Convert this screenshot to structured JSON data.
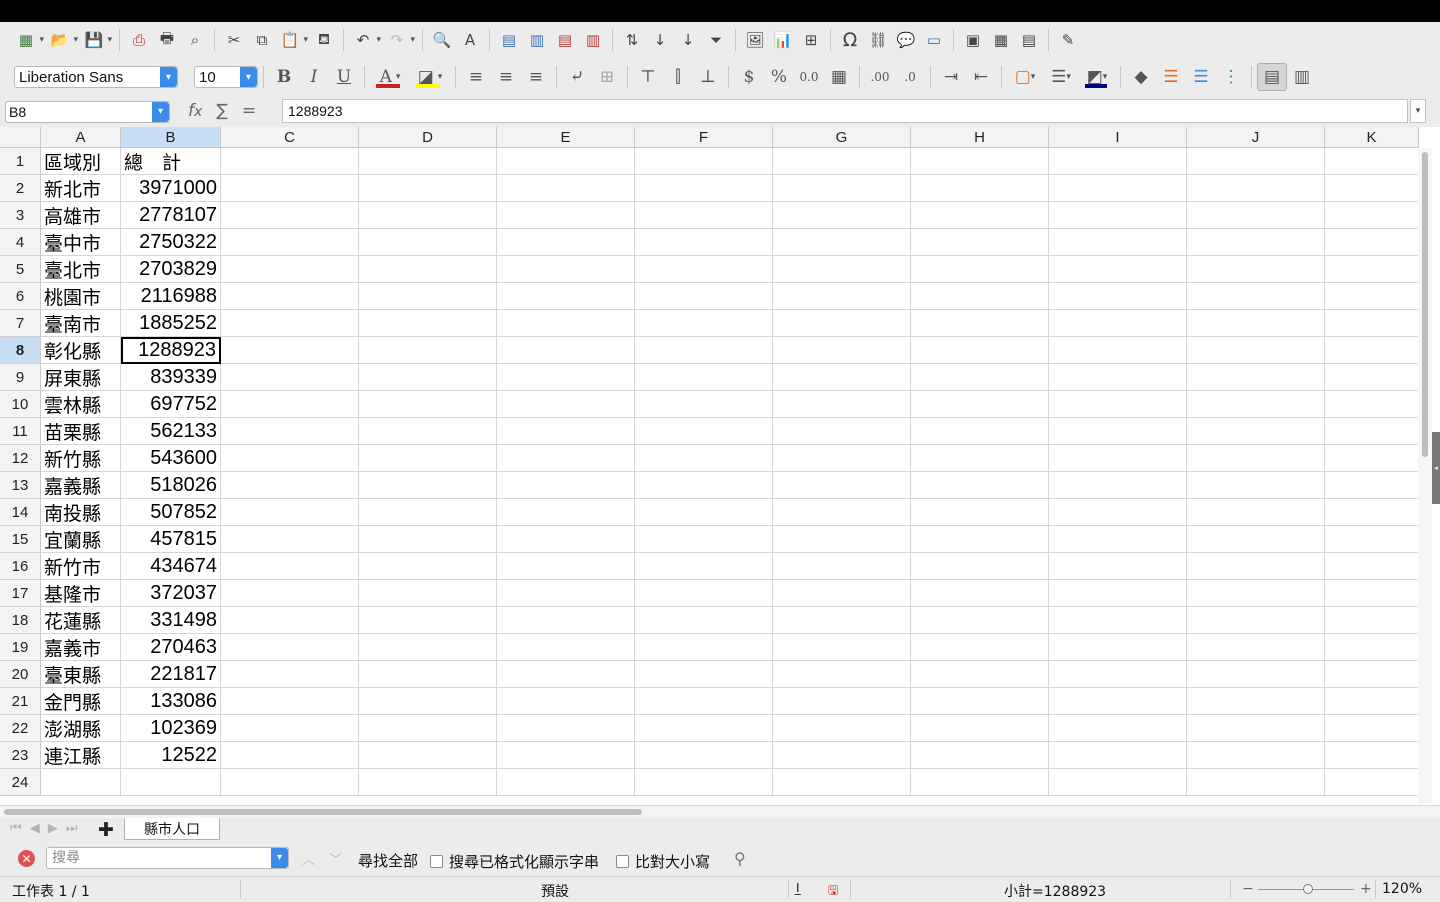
{
  "toolbar1": {
    "icons": [
      "table-icon",
      "open-icon",
      "save-icon",
      "export-pdf-icon",
      "print-icon",
      "print-preview-icon",
      "cut-icon",
      "copy-icon",
      "paste-icon",
      "clone-format-icon",
      "undo-icon",
      "redo-icon",
      "find-replace-icon",
      "spelling-icon",
      "row-icon",
      "column-icon",
      "delete-row-icon",
      "delete-column-icon",
      "sort-icon",
      "sort-ascending-icon",
      "sort-descending-icon",
      "autofilter-icon",
      "image-icon",
      "chart-icon",
      "pivot-table-icon",
      "special-character-icon",
      "hyperlink-icon",
      "comment-icon",
      "header-footer-icon",
      "define-print-area-icon",
      "freeze-rows-icon",
      "split-window-icon",
      "show-draw-functions-icon"
    ]
  },
  "format": {
    "font_name": "Liberation Sans",
    "font_size": "10",
    "font_color": "#c9211e",
    "highlight_color": "#ffff00",
    "border_color": "#000080"
  },
  "formula_bar": {
    "cell_ref": "B8",
    "content": "1288923"
  },
  "columns": [
    "A",
    "B",
    "C",
    "D",
    "E",
    "F",
    "G",
    "H",
    "I",
    "J",
    "K"
  ],
  "selected_column": "B",
  "selected_row": 8,
  "rows": [
    {
      "num": "1",
      "a": "區域別",
      "b": "總　計",
      "b_text": true
    },
    {
      "num": "2",
      "a": "新北市",
      "b": "3971000"
    },
    {
      "num": "3",
      "a": "高雄市",
      "b": "2778107"
    },
    {
      "num": "4",
      "a": "臺中市",
      "b": "2750322"
    },
    {
      "num": "5",
      "a": "臺北市",
      "b": "2703829"
    },
    {
      "num": "6",
      "a": "桃園市",
      "b": "2116988"
    },
    {
      "num": "7",
      "a": "臺南市",
      "b": "1885252"
    },
    {
      "num": "8",
      "a": "彰化縣",
      "b": "1288923"
    },
    {
      "num": "9",
      "a": "屏東縣",
      "b": "839339"
    },
    {
      "num": "10",
      "a": "雲林縣",
      "b": "697752"
    },
    {
      "num": "11",
      "a": "苗栗縣",
      "b": "562133"
    },
    {
      "num": "12",
      "a": "新竹縣",
      "b": "543600"
    },
    {
      "num": "13",
      "a": "嘉義縣",
      "b": "518026"
    },
    {
      "num": "14",
      "a": "南投縣",
      "b": "507852"
    },
    {
      "num": "15",
      "a": "宜蘭縣",
      "b": "457815"
    },
    {
      "num": "16",
      "a": "新竹市",
      "b": "434674"
    },
    {
      "num": "17",
      "a": "基隆市",
      "b": "372037"
    },
    {
      "num": "18",
      "a": "花蓮縣",
      "b": "331498"
    },
    {
      "num": "19",
      "a": "嘉義市",
      "b": "270463"
    },
    {
      "num": "20",
      "a": "臺東縣",
      "b": "221817"
    },
    {
      "num": "21",
      "a": "金門縣",
      "b": "133086"
    },
    {
      "num": "22",
      "a": "澎湖縣",
      "b": "102369"
    },
    {
      "num": "23",
      "a": "連江縣",
      "b": "12522"
    },
    {
      "num": "24",
      "a": "",
      "b": ""
    }
  ],
  "sheet_tab": "縣市人口",
  "find": {
    "placeholder": "搜尋",
    "find_all": "尋找全部",
    "formatted_display": "搜尋已格式化顯示字串",
    "match_case": "比對大小寫"
  },
  "status": {
    "sheet": "工作表 1 / 1",
    "page_style": "預設",
    "sum": "小計=1288923",
    "zoom": "120%"
  }
}
